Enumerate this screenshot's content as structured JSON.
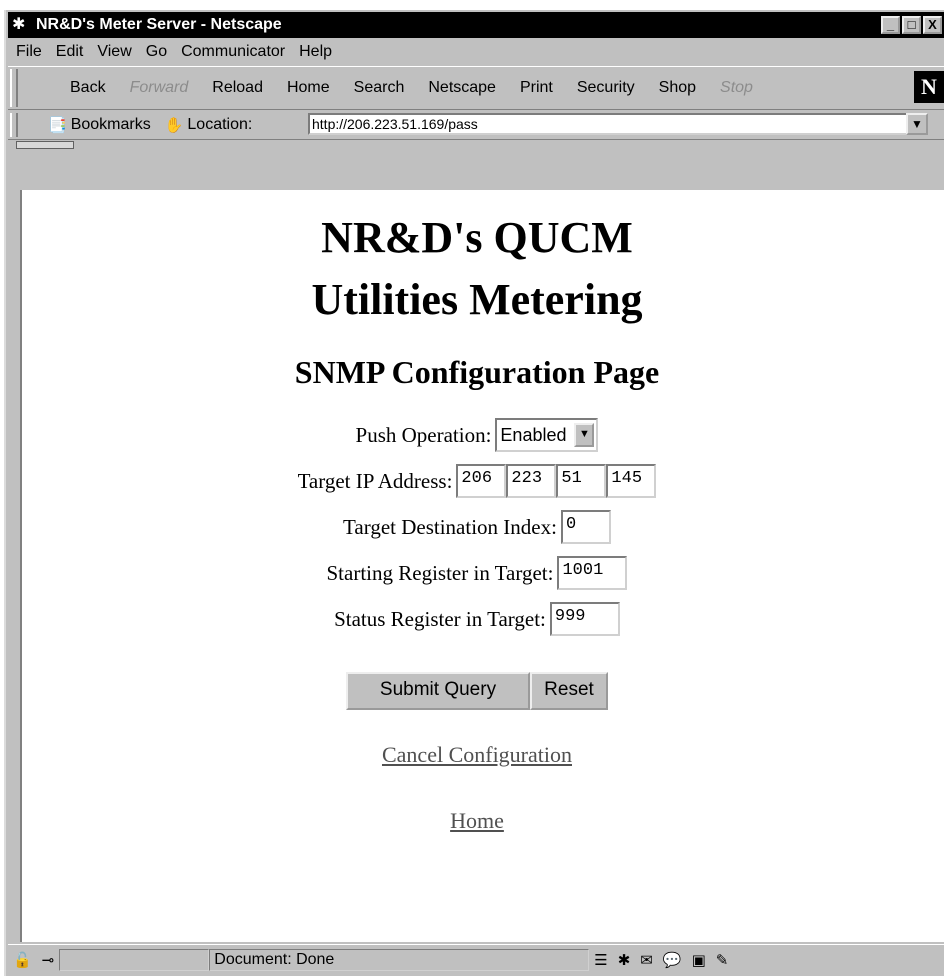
{
  "window": {
    "title": "NR&D's Meter Server - Netscape",
    "controls": [
      "_",
      "□",
      "X"
    ]
  },
  "menu": [
    "File",
    "Edit",
    "View",
    "Go",
    "Communicator",
    "Help"
  ],
  "toolbar": {
    "buttons": [
      {
        "label": "Back",
        "enabled": true
      },
      {
        "label": "Forward",
        "enabled": false
      },
      {
        "label": "Reload",
        "enabled": true
      },
      {
        "label": "Home",
        "enabled": true
      },
      {
        "label": "Search",
        "enabled": true
      },
      {
        "label": "Netscape",
        "enabled": true
      },
      {
        "label": "Print",
        "enabled": true
      },
      {
        "label": "Security",
        "enabled": true
      },
      {
        "label": "Shop",
        "enabled": true
      },
      {
        "label": "Stop",
        "enabled": false
      }
    ],
    "logo": "N"
  },
  "location": {
    "bookmarks_label": "Bookmarks",
    "location_label": "Location:",
    "url": "http://206.223.51.169/pass"
  },
  "page": {
    "heading_line1": "NR&D's QUCM",
    "heading_line2": "Utilities Metering",
    "subheading": "SNMP Configuration Page",
    "push_label": "Push Operation:",
    "push_value": "Enabled",
    "target_ip_label": "Target IP Address:",
    "ip": [
      "206",
      "223",
      "51",
      "145"
    ],
    "dest_index_label": "Target Destination Index:",
    "dest_index_value": "0",
    "start_reg_label": "Starting Register in Target:",
    "start_reg_value": "1001",
    "status_reg_label": "Status Register in Target:",
    "status_reg_value": "999",
    "submit_label": "Submit Query",
    "reset_label": "Reset",
    "cancel_link": "Cancel Configuration",
    "home_link": "Home"
  },
  "status": {
    "text": "Document: Done"
  }
}
